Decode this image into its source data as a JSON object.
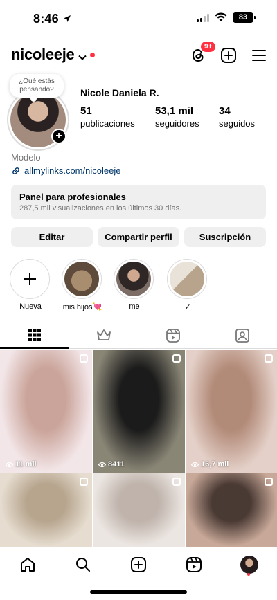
{
  "status_bar": {
    "time": "8:46",
    "battery": "83"
  },
  "header": {
    "username": "nicoleeje",
    "threads_badge": "9+"
  },
  "profile": {
    "note": "¿Qué estás pensando?",
    "full_name": "Nicole Daniela R.",
    "stats": [
      {
        "value": "51",
        "label": "publicaciones"
      },
      {
        "value": "53,1 mil",
        "label": "seguidores"
      },
      {
        "value": "34",
        "label": "seguidos"
      }
    ],
    "category": "Modelo",
    "link": "allmylinks.com/nicoleeje"
  },
  "dashboard": {
    "title": "Panel para profesionales",
    "subtitle": "287,5 mil visualizaciones en los últimos 30 días."
  },
  "buttons": {
    "edit": "Editar",
    "share": "Compartir perfil",
    "subscription": "Suscripción"
  },
  "highlights": [
    {
      "label": "Nueva",
      "color": "#ffffff"
    },
    {
      "label": "mis hijos💘",
      "color": "#8a7560"
    },
    {
      "label": "me",
      "color": "#3b3030"
    },
    {
      "label": "✓",
      "color": "#c9b9a6"
    }
  ],
  "posts": [
    {
      "views": "11 mil",
      "color_a": "#caa49a",
      "color_b": "#f3e6e8",
      "icon": "reel-icon"
    },
    {
      "views": "8411",
      "color_a": "#1b1b1b",
      "color_b": "#8a8676",
      "icon": "reel-icon"
    },
    {
      "views": "16,7 mil",
      "color_a": "#b28a78",
      "color_b": "#e4d0c8",
      "icon": "reel-icon"
    },
    {
      "views": "",
      "color_a": "#b7a58e",
      "color_b": "#e6ddd0",
      "icon": "carousel-icon"
    },
    {
      "views": "",
      "color_a": "#bfb3ab",
      "color_b": "#ece6e2",
      "icon": "carousel-icon"
    },
    {
      "views": "",
      "color_a": "#4a3a34",
      "color_b": "#c8a898",
      "icon": "reel-icon"
    }
  ]
}
